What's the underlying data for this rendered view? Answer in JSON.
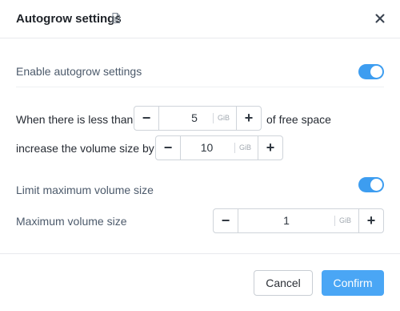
{
  "dialog": {
    "title": "Autogrow settings",
    "title_icon": "document-icon",
    "close_icon": "close-icon"
  },
  "autogrow": {
    "enable_label": "Enable autogrow settings",
    "enabled": true,
    "threshold_prefix": "When there is less than",
    "threshold_value": "5",
    "threshold_unit": "GiB",
    "threshold_suffix": "of free space",
    "increase_prefix": "increase the volume size by",
    "increase_value": "10",
    "increase_unit": "GiB"
  },
  "limit": {
    "enable_label": "Limit maximum volume size",
    "enabled": true,
    "max_label": "Maximum volume size",
    "max_value": "1",
    "max_unit": "GiB"
  },
  "stepper": {
    "minus": "−",
    "plus": "+"
  },
  "footer": {
    "cancel_label": "Cancel",
    "confirm_label": "Confirm"
  },
  "colors": {
    "accent": "#3d9df0",
    "confirm": "#4aa6f5"
  }
}
